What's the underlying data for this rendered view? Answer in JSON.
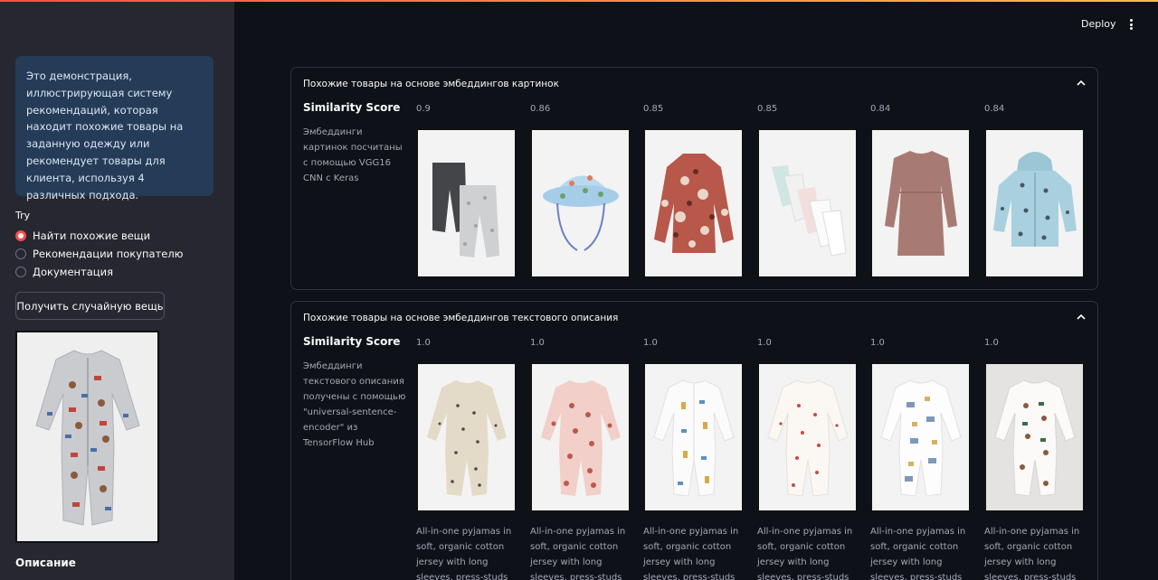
{
  "header": {
    "deploy_label": "Deploy",
    "menu_icon": "kebab-menu-icon"
  },
  "sidebar": {
    "info_text": "Это демонстрация, иллюстрирующая систему рекомендаций, которая находит похожие товары на заданную одежду или рекомендует товары для клиента, используя 4 различных подхода.",
    "try_label": "Try",
    "options": [
      {
        "label": "Найти похожие вещи",
        "selected": true
      },
      {
        "label": "Рекомендации покупателю",
        "selected": false
      },
      {
        "label": "Документация",
        "selected": false
      }
    ],
    "random_button_label": "Получить случайную вещь",
    "description_label": "Описание"
  },
  "panels": [
    {
      "title": "Похожие товары на основе эмбеддингов картинок",
      "score_title": "Similarity Score",
      "method_text": "Эмбеддинги картинок посчитаны с помощью VGG16 CNN с Keras",
      "items": [
        {
          "score": "0.9",
          "product": "baby-trousers"
        },
        {
          "score": "0.86",
          "product": "sun-hat"
        },
        {
          "score": "0.85",
          "product": "floral-blouse"
        },
        {
          "score": "0.85",
          "product": "bodysuits-set"
        },
        {
          "score": "0.84",
          "product": "nursing-dress"
        },
        {
          "score": "0.84",
          "product": "hooded-jacket"
        }
      ]
    },
    {
      "title": "Похожие товары на основе эмбеддингов текстового описания",
      "score_title": "Similarity Score",
      "method_text": "Эмбеддинги текстового описания получены с помощью \"universal-sentence-encoder\" из TensorFlow Hub",
      "items": [
        {
          "score": "1.0",
          "product": "pyjamas-beige-dots",
          "caption": "All-in-one pyjamas in soft, organic cotton jersey with long sleeves, press-studs down the"
        },
        {
          "score": "1.0",
          "product": "pyjamas-pink-hearts",
          "caption": "All-in-one pyjamas in soft, organic cotton jersey with long sleeves, press-studs down the"
        },
        {
          "score": "1.0",
          "product": "pyjamas-white-giraffes",
          "caption": "All-in-one pyjamas in soft, organic cotton jersey with long sleeves, press-studs down the"
        },
        {
          "score": "1.0",
          "product": "pyjamas-white-hearts",
          "caption": "All-in-one pyjamas in soft, organic cotton jersey with long sleeves, press-studs down the"
        },
        {
          "score": "1.0",
          "product": "pyjamas-white-dinos",
          "caption": "All-in-one pyjamas in soft, organic cotton jersey with long sleeves, press-studs down the"
        },
        {
          "score": "1.0",
          "product": "pyjamas-white-bears",
          "caption": "All-in-one pyjamas in soft, organic cotton jersey with long sleeves, press-studs down the"
        }
      ]
    }
  ],
  "colors": {
    "accent": "#ff4b4b",
    "info_bg": "#253c58",
    "sidebar_bg": "#262730",
    "main_bg": "#0e1117"
  }
}
